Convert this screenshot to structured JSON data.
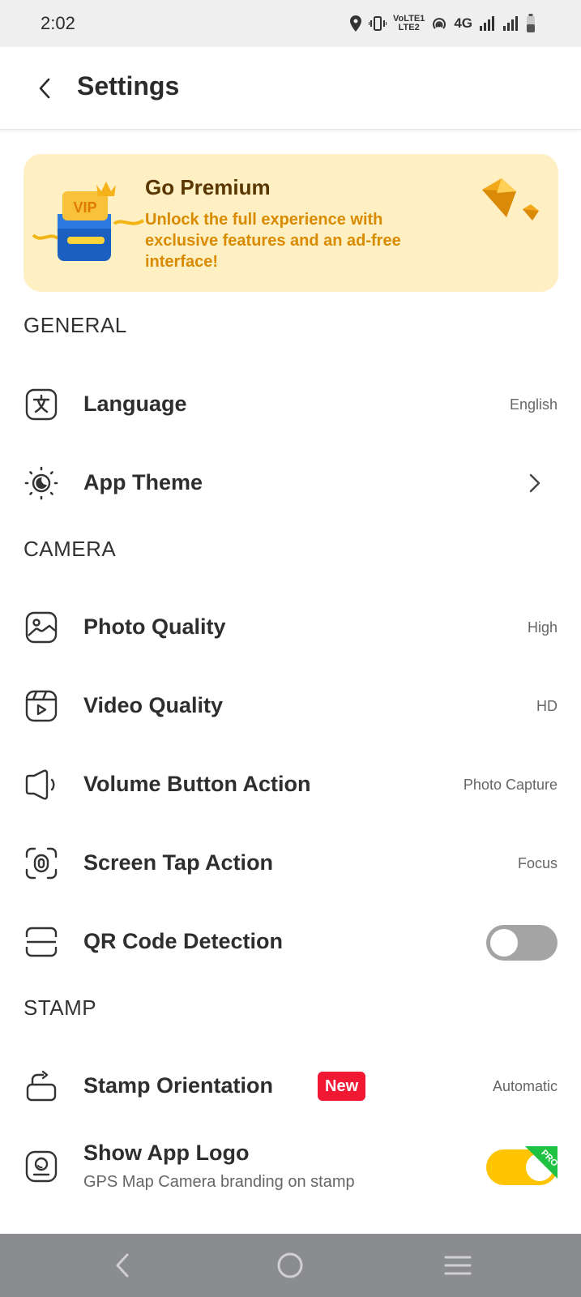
{
  "status_bar": {
    "time": "2:02",
    "volte_top": "VoLTE1",
    "volte_bottom": "LTE2",
    "network": "4G",
    "icons": [
      "location-icon",
      "vibrate-icon",
      "volte-icon",
      "hotspot-icon",
      "signal-icon",
      "signal-icon",
      "battery-icon"
    ]
  },
  "header": {
    "title": "Settings",
    "back_icon": "back-arrow-icon"
  },
  "premium": {
    "title": "Go Premium",
    "description": "Unlock the full experience with exclusive features and an ad-free interface!",
    "vip_label": "VIP",
    "art": [
      "vip-box-icon",
      "crown-icon",
      "diamond-icon"
    ]
  },
  "sections": {
    "general": "GENERAL",
    "camera": "CAMERA",
    "stamp": "STAMP"
  },
  "settings": {
    "language": {
      "label": "Language",
      "value": "English",
      "icon": "translate-icon"
    },
    "app_theme": {
      "label": "App Theme",
      "icon": "theme-icon"
    },
    "photo_quality": {
      "label": "Photo Quality",
      "value": "High",
      "icon": "image-icon"
    },
    "video_quality": {
      "label": "Video Quality",
      "value": "HD",
      "icon": "video-icon"
    },
    "volume_button": {
      "label": "Volume Button Action",
      "value": "Photo Capture",
      "icon": "volume-icon"
    },
    "screen_tap": {
      "label": "Screen Tap Action",
      "value": "Focus",
      "icon": "tap-icon"
    },
    "qr_detection": {
      "label": "QR Code Detection",
      "enabled": false,
      "icon": "qr-scan-icon"
    },
    "stamp_orientation": {
      "label": "Stamp Orientation",
      "badge": "New",
      "value": "Automatic",
      "icon": "rotate-icon"
    },
    "show_logo": {
      "label": "Show App Logo",
      "sublabel": "GPS Map Camera branding on stamp",
      "enabled": true,
      "pro_badge": "PRO",
      "icon": "logo-icon"
    }
  },
  "colors": {
    "premium_bg": "#fff0c4",
    "premium_title": "#5a3600",
    "premium_text": "#d88a00",
    "toggle_on": "#ffc400",
    "toggle_off": "#a4a4a4",
    "new_badge": "#f01833",
    "pro_badge": "#1fc243",
    "nav_bar": "#8a8c8f"
  },
  "nav": {
    "icons": [
      "nav-back-icon",
      "nav-home-icon",
      "nav-menu-icon"
    ]
  }
}
